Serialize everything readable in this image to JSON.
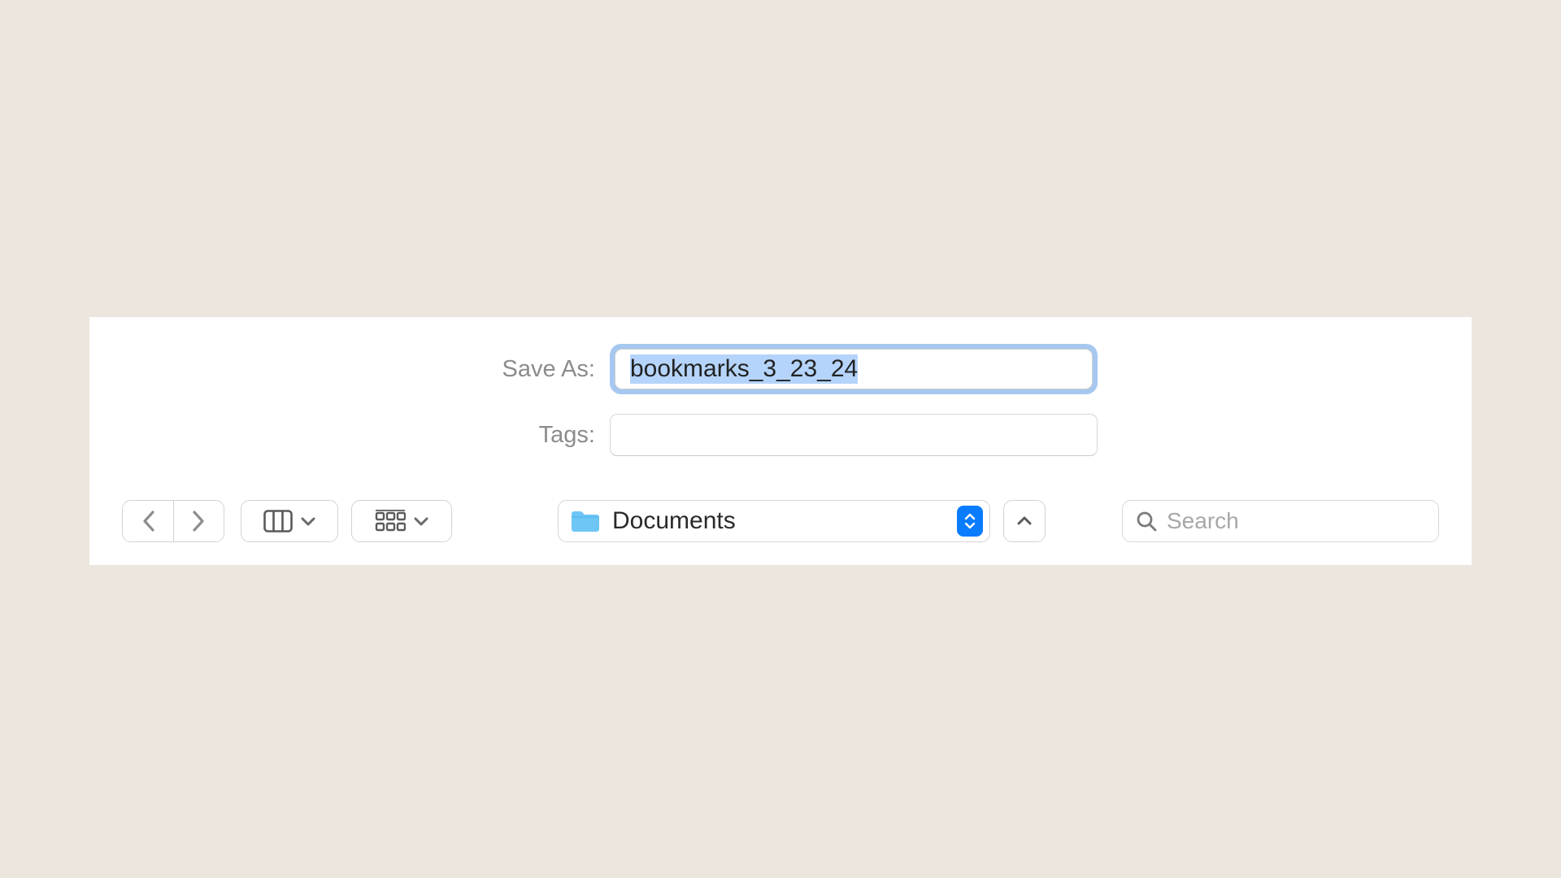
{
  "saveAs": {
    "label": "Save As:",
    "value": "bookmarks_3_23_24"
  },
  "tags": {
    "label": "Tags:",
    "value": ""
  },
  "location": {
    "folder": "Documents"
  },
  "search": {
    "placeholder": "Search",
    "value": ""
  }
}
